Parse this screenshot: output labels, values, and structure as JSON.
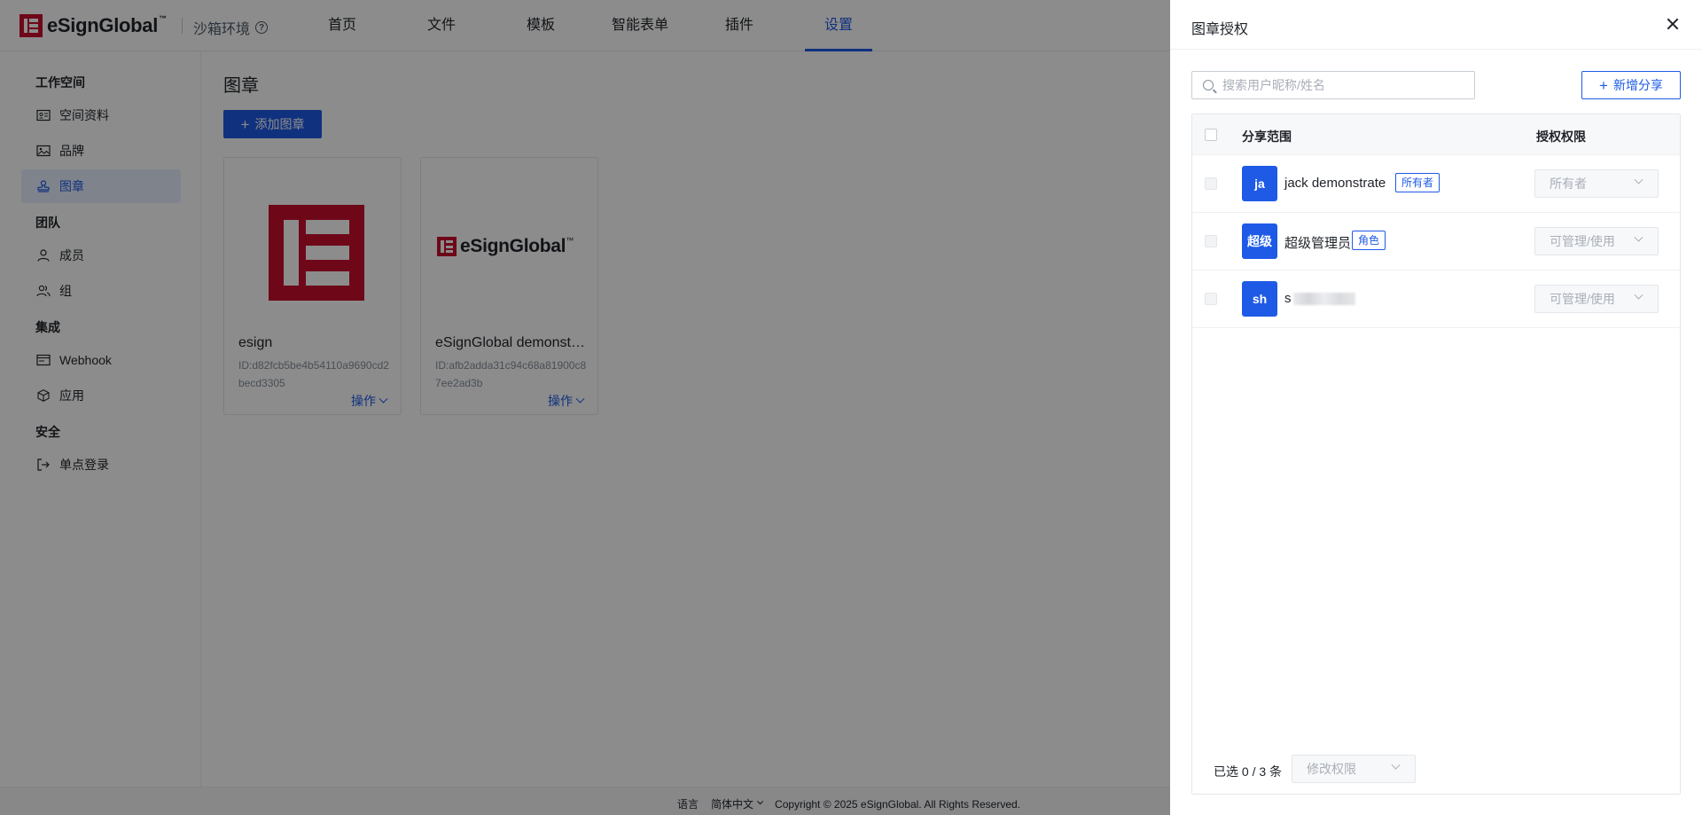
{
  "app": {
    "logo_text": "eSignGlobal",
    "logo_tm": "™",
    "environment": "沙箱环境"
  },
  "nav": {
    "items": [
      "首页",
      "文件",
      "模板",
      "智能表单",
      "插件",
      "设置"
    ],
    "active": "设置"
  },
  "sidebar": {
    "groups": [
      {
        "title": "工作空间",
        "items": [
          {
            "label": "空间资料",
            "icon": "id-card-icon"
          },
          {
            "label": "品牌",
            "icon": "image-icon"
          },
          {
            "label": "图章",
            "icon": "stamp-icon",
            "active": true
          }
        ]
      },
      {
        "title": "团队",
        "items": [
          {
            "label": "成员",
            "icon": "user-icon"
          },
          {
            "label": "组",
            "icon": "users-icon"
          }
        ]
      },
      {
        "title": "集成",
        "items": [
          {
            "label": "Webhook",
            "icon": "webhook-icon"
          },
          {
            "label": "应用",
            "icon": "cube-icon"
          }
        ]
      },
      {
        "title": "安全",
        "items": [
          {
            "label": "单点登录",
            "icon": "login-icon"
          }
        ]
      }
    ]
  },
  "main": {
    "title": "图章",
    "add_button": "添加图章",
    "cards": [
      {
        "name": "esign",
        "id": "ID:d82fcb5be4b54110a9690cd2becd3305",
        "action": "操作"
      },
      {
        "name": "eSignGlobal demonstrate",
        "id": "ID:afb2adda31c94c68a81900c87ee2ad3b",
        "action": "操作"
      }
    ]
  },
  "footer": {
    "language_label": "语言",
    "language_value": "简体中文",
    "copyright": "Copyright © 2025 eSignGlobal. All Rights Reserved."
  },
  "drawer": {
    "title": "图章授权",
    "search_placeholder": "搜索用户昵称/姓名",
    "new_share_button": "新增分享",
    "columns": {
      "range": "分享范围",
      "permission": "授权权限"
    },
    "rows": [
      {
        "avatar": "ja",
        "name": "jack demonstrate",
        "tag": "所有者",
        "permission": "所有者"
      },
      {
        "avatar": "超级",
        "name": "超级管理员",
        "tag": "角色",
        "permission": "可管理/使用"
      },
      {
        "avatar": "sh",
        "name": "s",
        "tag": "",
        "permission": "可管理/使用",
        "name_redacted": true
      }
    ],
    "selected_count": "已选 0 / 3 条",
    "modify_permission": "修改权限"
  },
  "colors": {
    "accent": "#1e5ae6",
    "brand": "#c8102e"
  }
}
